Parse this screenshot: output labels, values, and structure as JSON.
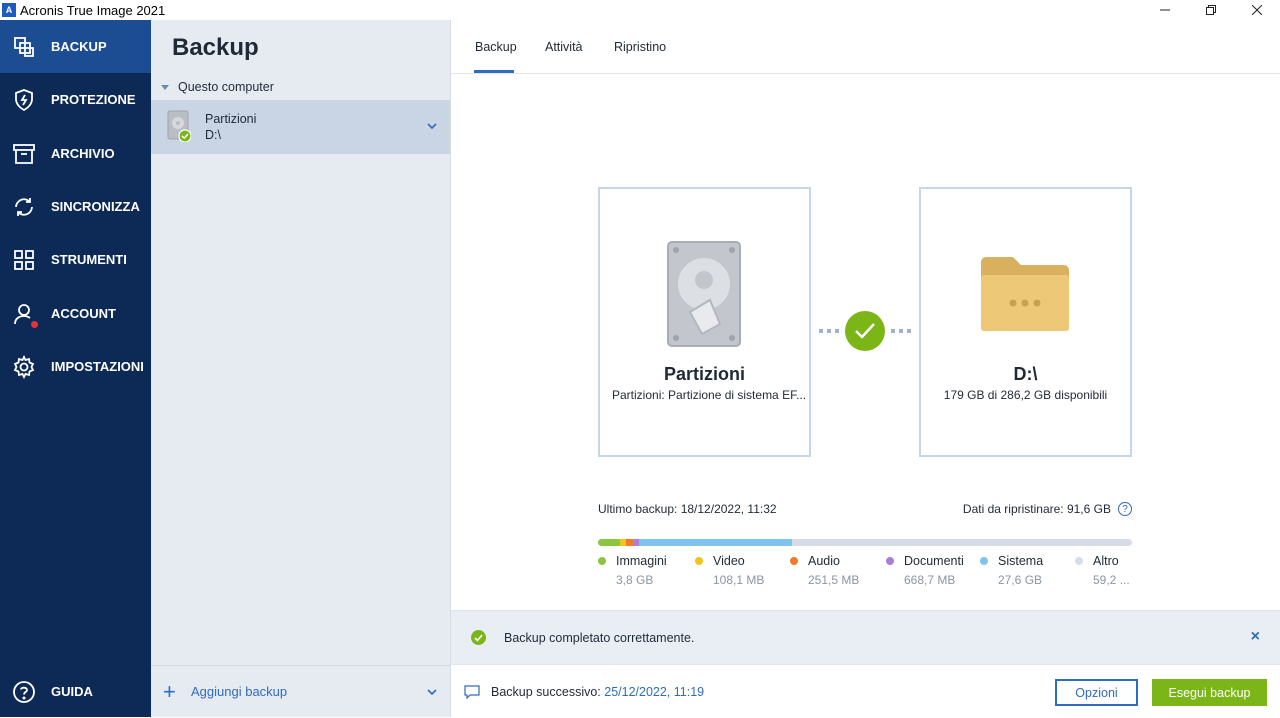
{
  "window": {
    "title": "Acronis True Image 2021",
    "app_icon_letter": "A"
  },
  "nav": {
    "items": [
      {
        "label": "BACKUP",
        "icon": "backup-copies-icon",
        "active": true
      },
      {
        "label": "PROTEZIONE",
        "icon": "shield-icon"
      },
      {
        "label": "ARCHIVIO",
        "icon": "archive-box-icon"
      },
      {
        "label": "SINCRONIZZA",
        "icon": "sync-icon"
      },
      {
        "label": "STRUMENTI",
        "icon": "grid-tools-icon"
      },
      {
        "label": "ACCOUNT",
        "icon": "user-icon",
        "alert": true
      },
      {
        "label": "IMPOSTAZIONI",
        "icon": "gear-icon"
      }
    ],
    "help": {
      "label": "GUIDA",
      "icon": "help-icon"
    }
  },
  "list": {
    "title": "Backup",
    "group": "Questo computer",
    "items": [
      {
        "name": "Partizioni",
        "destination": "D:\\",
        "status": "ok"
      }
    ],
    "add_label": "Aggiungi backup"
  },
  "tabs": [
    {
      "label": "Backup",
      "active": true
    },
    {
      "label": "Attività"
    },
    {
      "label": "Ripristino"
    }
  ],
  "source": {
    "title": "Partizioni",
    "subtitle": "Partizioni: Partizione di sistema EF..."
  },
  "destination": {
    "title": "D:\\",
    "subtitle": "179 GB di 286,2 GB disponibili"
  },
  "stats": {
    "last_backup": "Ultimo backup: 18/12/2022, 11:32",
    "restore_data": "Dati da ripristinare: 91,6 GB"
  },
  "usage": {
    "segments": [
      {
        "name": "Immagini",
        "value": "3,8 GB",
        "color": "#8cc63f",
        "fraction": 0.041
      },
      {
        "name": "Video",
        "value": "108,1 MB",
        "color": "#f2c31d",
        "fraction": 0.012
      },
      {
        "name": "Audio",
        "value": "251,5 MB",
        "color": "#f07c27",
        "fraction": 0.012
      },
      {
        "name": "Documenti",
        "value": "668,7 MB",
        "color": "#a980d6",
        "fraction": 0.012
      },
      {
        "name": "Sistema",
        "value": "27,6 GB",
        "color": "#7fc3ef",
        "fraction": 0.287
      },
      {
        "name": "Altro",
        "value": "59,2 ...",
        "color": "#d7dde6",
        "fraction": 0.636
      }
    ]
  },
  "notice": {
    "text": "Backup completato correttamente.",
    "close": "×"
  },
  "footer": {
    "next_label": "Backup successivo: ",
    "next_date": "25/12/2022, 11:19",
    "options_label": "Opzioni",
    "run_label": "Esegui backup"
  },
  "colors": {
    "nav_bg": "#0d2a57",
    "nav_active": "#1c4c91",
    "accent": "#2f6bbf",
    "success": "#7cb518"
  }
}
